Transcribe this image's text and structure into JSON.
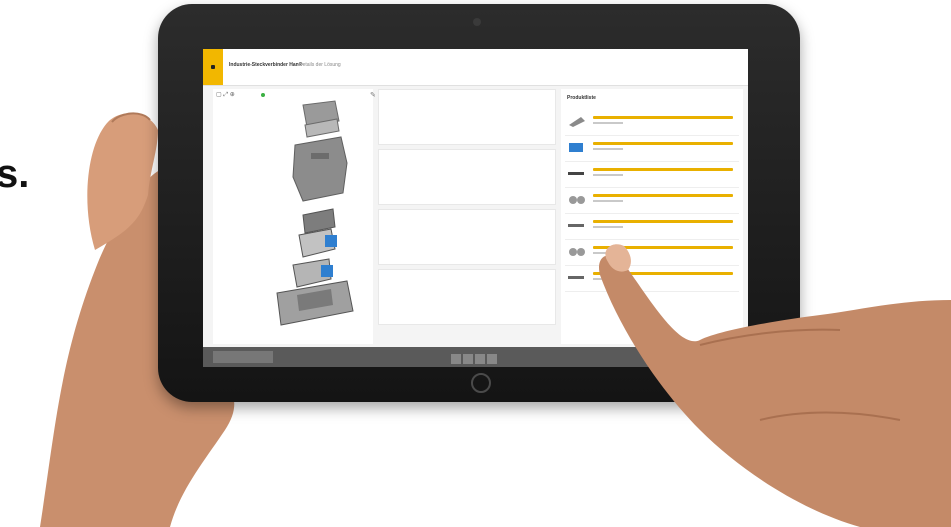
{
  "left_edge_text": "s.",
  "app": {
    "title": "Industrie-Steckverbinder Han®",
    "subtitle": "Details der Lösung",
    "view_controls": "▢ ⤢ ⊕"
  },
  "colors": {
    "accent": "#f2b700",
    "status": "#3cb043"
  },
  "icons": [
    "menu-icon",
    "edit-icon",
    "view-toggle-icon",
    "status-dot"
  ],
  "product_list": {
    "heading": "Produktliste",
    "count": 7
  },
  "assembly_slots": 4
}
